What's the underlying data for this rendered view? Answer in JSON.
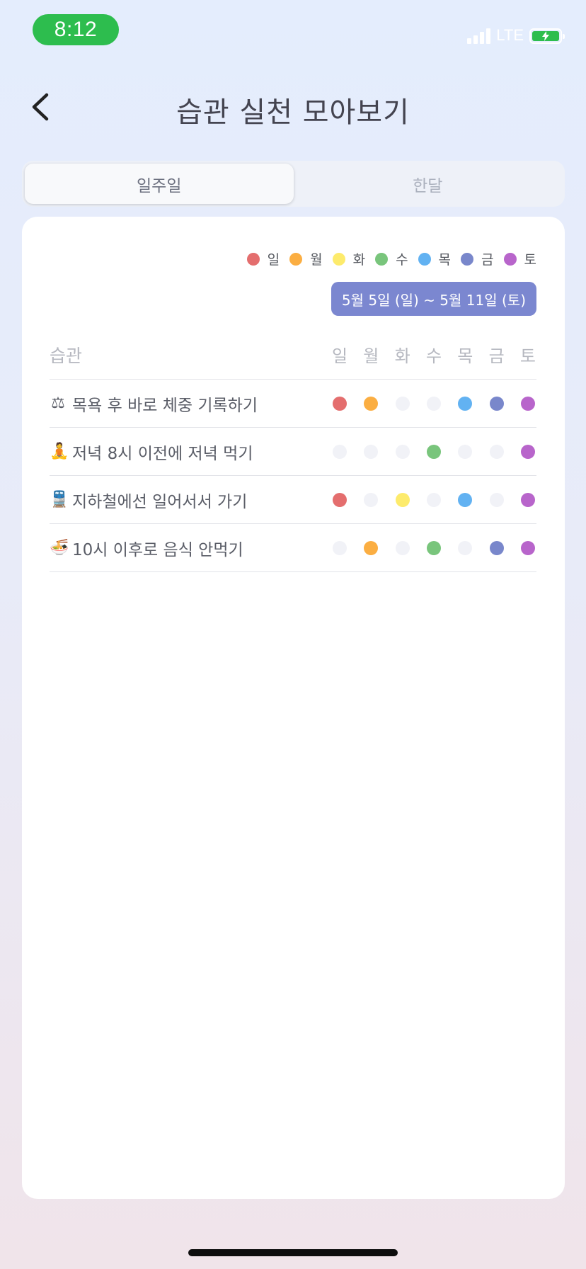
{
  "status": {
    "time": "8:12",
    "network": "LTE"
  },
  "header": {
    "title": "습관 실천 모아보기"
  },
  "tabs": [
    {
      "label": "일주일",
      "active": true
    },
    {
      "label": "한달",
      "active": false
    }
  ],
  "legend": [
    {
      "label": "일",
      "color": "#e46e6e"
    },
    {
      "label": "월",
      "color": "#fbae42"
    },
    {
      "label": "화",
      "color": "#fdeb6c"
    },
    {
      "label": "수",
      "color": "#79c57c"
    },
    {
      "label": "목",
      "color": "#62b2f2"
    },
    {
      "label": "금",
      "color": "#7987cb"
    },
    {
      "label": "토",
      "color": "#b865cb"
    }
  ],
  "range": "5월 5일 (일) ~ 5월 11일 (토)",
  "table": {
    "habit_header": "습관",
    "day_headers": [
      "일",
      "월",
      "화",
      "수",
      "목",
      "금",
      "토"
    ],
    "rows": [
      {
        "emoji": "⚖",
        "name": "목욕 후 바로 체중 기록하기",
        "done": [
          true,
          true,
          false,
          false,
          true,
          true,
          true
        ]
      },
      {
        "emoji": "🧘",
        "name": "저녁 8시 이전에 저녁 먹기",
        "done": [
          false,
          false,
          false,
          true,
          false,
          false,
          true
        ]
      },
      {
        "emoji": "🚆",
        "name": "지하철에선 일어서서 가기",
        "done": [
          true,
          false,
          true,
          false,
          true,
          false,
          true
        ]
      },
      {
        "emoji": "🍜",
        "name": "10시 이후로 음식 안먹기",
        "done": [
          false,
          true,
          false,
          true,
          false,
          true,
          true
        ]
      }
    ]
  }
}
